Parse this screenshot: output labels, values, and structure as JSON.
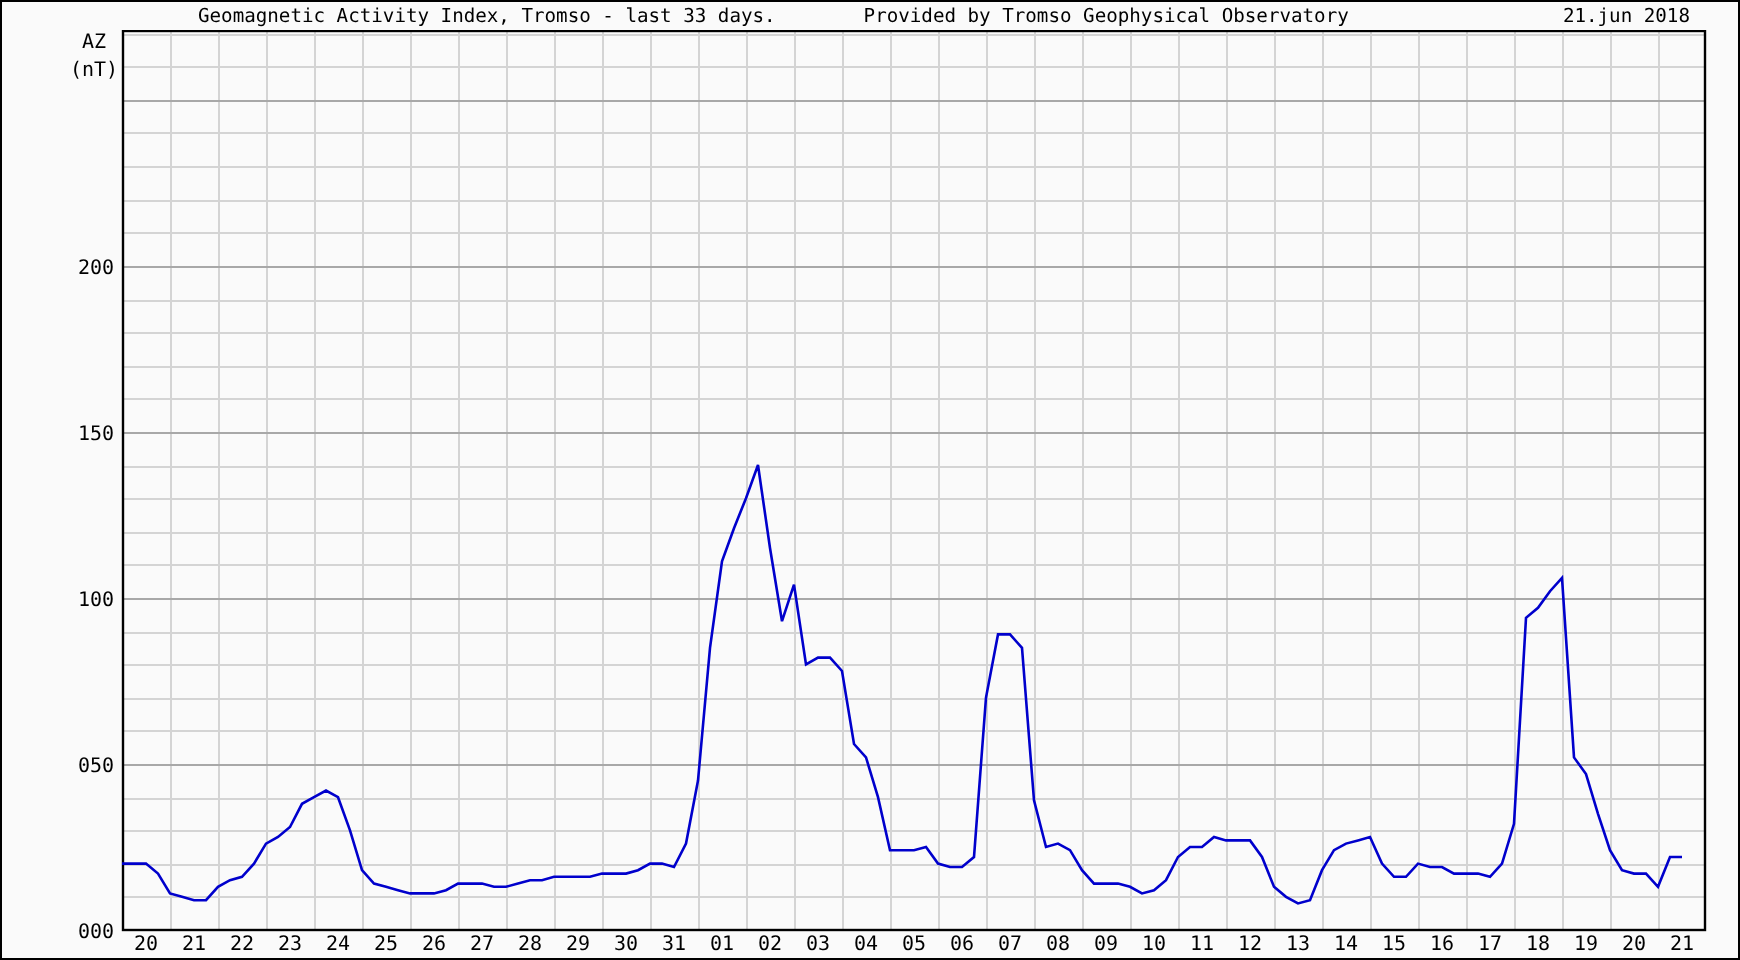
{
  "header": {
    "title": "Geomagnetic Activity Index, Tromso - last 33 days.",
    "provider": "Provided by Tromso Geophysical Observatory",
    "date": "21.jun 2018"
  },
  "chart": {
    "unit": "(nT)",
    "chart_data": {
      "type": "line",
      "grid": true,
      "ylabel": "AZ",
      "ylim": [
        0,
        271
      ],
      "yticks": [
        {
          "value": 0,
          "label": "000"
        },
        {
          "value": 50,
          "label": "050"
        },
        {
          "value": 100,
          "label": "100"
        },
        {
          "value": 150,
          "label": "150"
        },
        {
          "value": 200,
          "label": "200"
        }
      ],
      "categories": [
        null,
        null,
        "20",
        null,
        null,
        null,
        "21",
        null,
        null,
        null,
        "22",
        null,
        null,
        null,
        "23",
        null,
        null,
        null,
        "24",
        null,
        null,
        null,
        "25",
        null,
        null,
        null,
        "26",
        null,
        null,
        null,
        "27",
        null,
        null,
        null,
        "28",
        null,
        null,
        null,
        "29",
        null,
        null,
        null,
        "30",
        null,
        null,
        null,
        "31",
        null,
        null,
        null,
        "01",
        null,
        null,
        null,
        "02",
        null,
        null,
        null,
        "03",
        null,
        null,
        null,
        "04",
        null,
        null,
        null,
        "05",
        null,
        null,
        null,
        "06",
        null,
        null,
        null,
        "07",
        null,
        null,
        null,
        "08",
        null,
        null,
        null,
        "09",
        null,
        null,
        null,
        "10",
        null,
        null,
        null,
        "11",
        null,
        null,
        null,
        "12",
        null,
        null,
        null,
        "13",
        null,
        null,
        null,
        "14",
        null,
        null,
        null,
        "15",
        null,
        null,
        null,
        "16",
        null,
        null,
        null,
        "17",
        null,
        null,
        null,
        "18",
        null,
        null,
        null,
        "19",
        null,
        null,
        null,
        "20",
        null,
        null,
        null,
        "21",
        null
      ],
      "series": [
        {
          "color": "#0000cc",
          "values": [
            20,
            20,
            20,
            17,
            11,
            10,
            9,
            9,
            13,
            15,
            16,
            20,
            26,
            28,
            31,
            38,
            40,
            42,
            40,
            30,
            18,
            14,
            13,
            12,
            11,
            11,
            11,
            12,
            14,
            14,
            14,
            13,
            13,
            14,
            15,
            15,
            16,
            16,
            16,
            16,
            17,
            17,
            17,
            18,
            20,
            20,
            19,
            26,
            45,
            85,
            111,
            121,
            130,
            140,
            115,
            93,
            104,
            80,
            82,
            82,
            78,
            56,
            52,
            40,
            24,
            24,
            24,
            25,
            20,
            19,
            19,
            22,
            70,
            89,
            89,
            85,
            39,
            25,
            26,
            24,
            18,
            14,
            14,
            14,
            13,
            11,
            12,
            15,
            22,
            25,
            25,
            28,
            27,
            27,
            27,
            22,
            13,
            10,
            8,
            9,
            18,
            24,
            26,
            27,
            28,
            20,
            16,
            16,
            20,
            19,
            19,
            17,
            17,
            17,
            16,
            20,
            32,
            94,
            97,
            102,
            106,
            52,
            47,
            35,
            24,
            18,
            17,
            17,
            13,
            22,
            22,
            null
          ]
        }
      ]
    }
  }
}
